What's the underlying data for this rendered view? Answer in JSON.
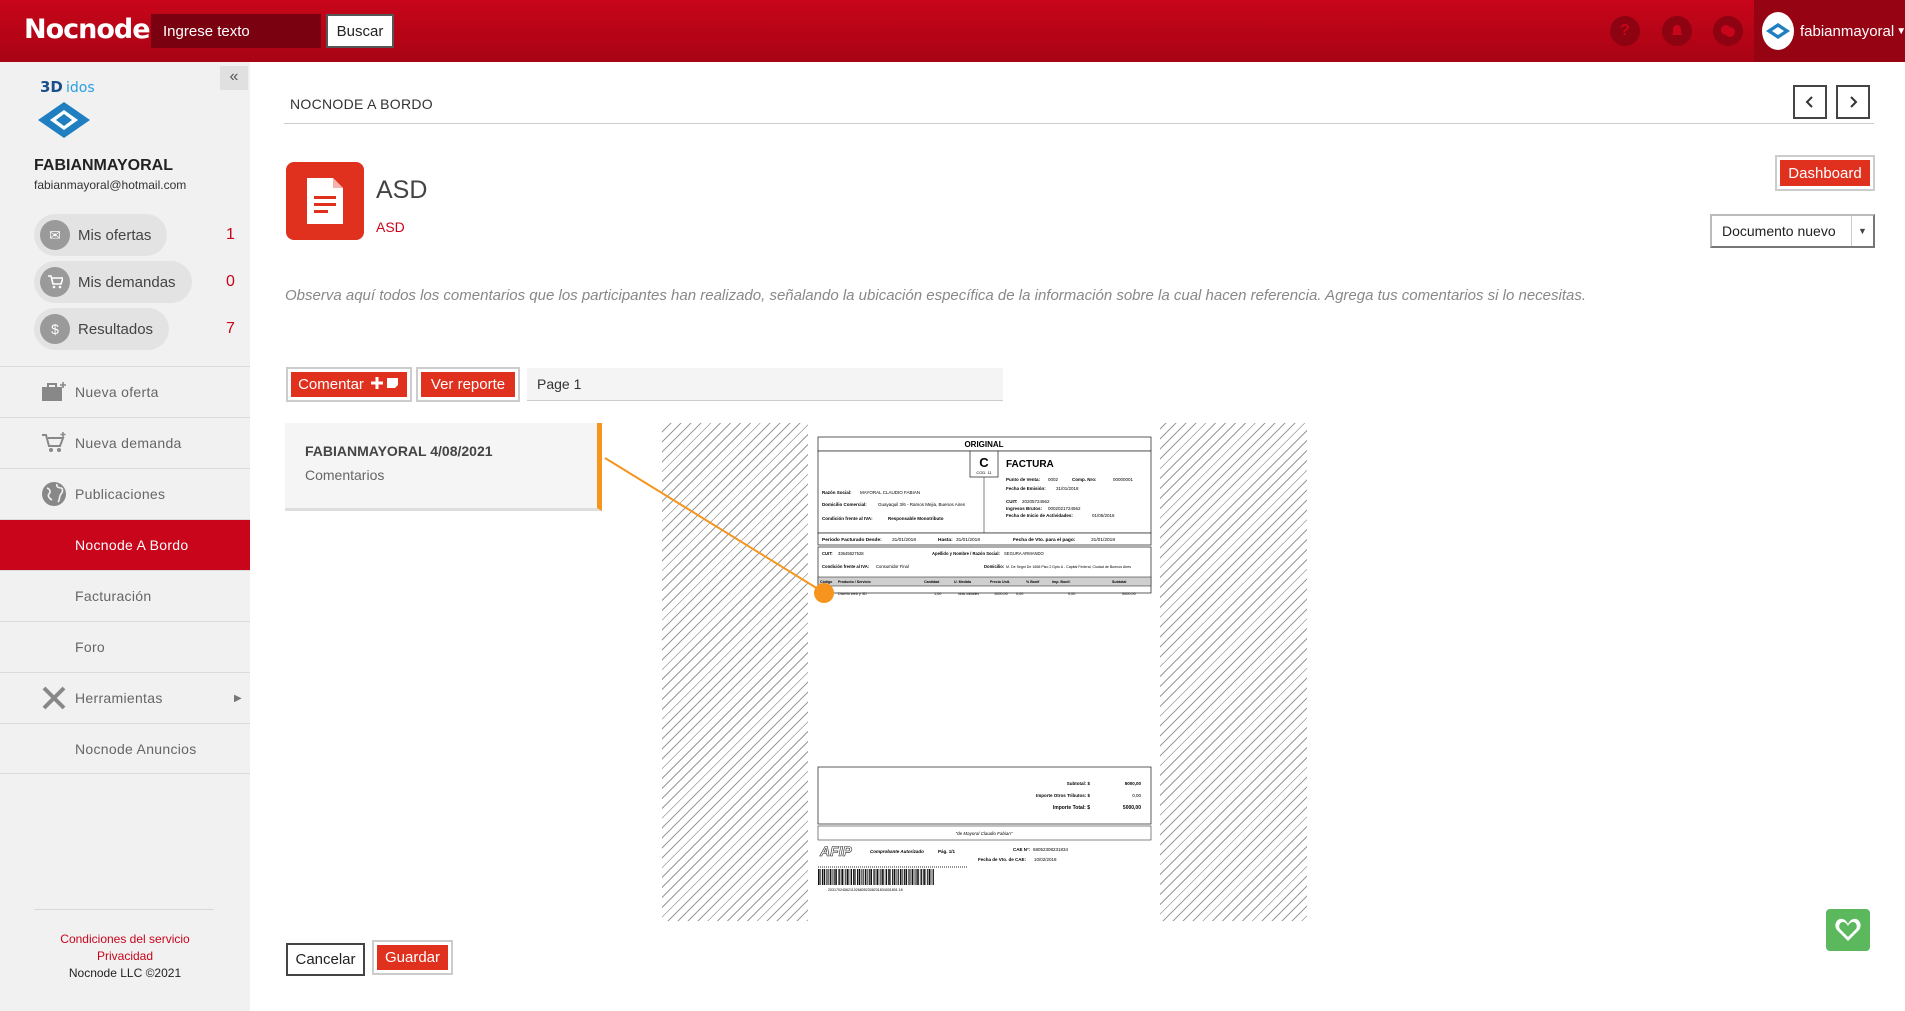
{
  "header": {
    "brand": "Nocnode",
    "search_value": "Ingrese texto",
    "search_button": "Buscar",
    "icons": [
      "help-icon",
      "bell-icon",
      "chat-icon"
    ],
    "user_name": "fabianmayoral"
  },
  "sidebar": {
    "logo_text": "3Didos",
    "profile_name": "FABIANMAYORAL",
    "profile_email": "fabianmayoral@hotmail.com",
    "stats": [
      {
        "label": "Mis ofertas",
        "count": "1",
        "icon": "envelope-icon"
      },
      {
        "label": "Mis demandas",
        "count": "0",
        "icon": "cart-icon"
      },
      {
        "label": "Resultados",
        "count": "7",
        "icon": "dollar-icon"
      }
    ],
    "nav": [
      {
        "label": "Nueva oferta",
        "icon": "briefcase-plus-icon"
      },
      {
        "label": "Nueva demanda",
        "icon": "cart-plus-icon"
      },
      {
        "label": "Publicaciones",
        "icon": "globe-icon"
      },
      {
        "label": "Nocnode A Bordo",
        "active": true
      },
      {
        "label": "Facturación"
      },
      {
        "label": "Foro"
      },
      {
        "label": "Herramientas",
        "icon": "tools-icon"
      },
      {
        "label": "Nocnode Anuncios"
      }
    ],
    "footer": {
      "terms": "Condiciones del servicio",
      "privacy": "Privacidad",
      "copyright": "Nocnode LLC ©2021"
    }
  },
  "main": {
    "breadcrumb": "NOCNODE A BORDO",
    "doc_title": "ASD",
    "doc_subtitle": "ASD",
    "dashboard_button": "Dashboard",
    "document_select": "Documento nuevo",
    "instructions": "Observa aquí todos los comentarios que los participantes han realizado, señalando la ubicación específica de la información sobre la cual hacen referencia. Agrega tus comentarios si lo necesitas.",
    "comment_button": "Comentar",
    "report_button": "Ver reporte",
    "page_label": "Page 1",
    "comment": {
      "author": "FABIANMAYORAL 4/08/2021",
      "text": "Comentarios"
    },
    "invoice": {
      "original": "ORIGINAL",
      "letter": "C",
      "letter_code": "COD. 11",
      "title": "FACTURA",
      "punto_venta": "Punto de Venta:",
      "punto_venta_val": "0002",
      "comp_nro": "Comp. Nro:",
      "comp_nro_val": "00000001",
      "fecha_emision": "Fecha de Emisión:",
      "fecha_emision_val": "31/01/2018",
      "razon_social": "Razón Social:",
      "razon_social_val": "MAYORAL CLAUDIO FABIAN",
      "domicilio": "Domicilio Comercial:",
      "domicilio_val": "Guayaquil 3/6 - Ramos Mejia, Buenos Aires",
      "condicion_iva": "Condición frente al IVA:",
      "condicion_iva_val": "Responsable Monotributo",
      "cuit": "CUIT:",
      "cuit_val": "20205724562",
      "ingresos_brutos": "Ingresos Brutos:",
      "ingresos_brutos_val": "0002021724562",
      "inicio_act": "Fecha de Inicio de Actividades:",
      "inicio_act_val": "01/05/2016",
      "periodo_desde": "Período Facturado Desde:",
      "periodo_desde_val": "31/01/2018",
      "hasta": "Hasta:",
      "hasta_val": "31/01/2018",
      "vto_pago": "Fecha de Vto. para el pago:",
      "vto_pago_val": "31/01/2018",
      "cliente_cuit": "CUIT:",
      "cliente_cuit_val": "33645827528",
      "cliente_nombre": "Apellido y Nombre / Razón Social:",
      "cliente_nombre_val": "SEGURA ARMANDO",
      "cliente_iva": "Condición frente al IVA:",
      "cliente_iva_val": "Consumidor Final",
      "cliente_dom": "Domicilio:",
      "cliente_dom_val": "M. De Segni De 1658 Piso 2 Dpto A - Capital Federal, Ciudad de Buenos Aires",
      "condicion_venta": "Condición de venta:",
      "condicion_venta_val": "Contado",
      "table_headers": [
        "Código",
        "Producto / Servicio",
        "Cantidad",
        "U. Medida",
        "Precio Unit.",
        "% Bonif",
        "Imp. Bonif.",
        "Subtotal"
      ],
      "row": [
        "",
        "Diseño web y 3D",
        "1,00",
        "otras unidades",
        "1000,00",
        "0,00",
        "0,00",
        "5000,00"
      ],
      "subtotal": "Subtotal: $",
      "subtotal_val": "5000,00",
      "otros_tributos": "Importe Otros Tributos: $",
      "otros_tributos_val": "0,00",
      "total": "Importe Total: $",
      "total_val": "5000,00",
      "signature": "\"de Mayoral Claudio Fabian\"",
      "afip": "AFIP",
      "autorizado": "Comprobante Autorizado",
      "pag": "Pág. 1/1",
      "cae": "CAE N°:",
      "cae_val": "68052308231834",
      "vto_cae": "Fecha de Vto. de CAE:",
      "vto_cae_val": "10/02/2018",
      "barcode_number": "20317024562110268052308231834001801 18"
    },
    "cancel_button": "Cancelar",
    "save_button": "Guardar"
  },
  "colors": {
    "brand_red": "#c8051a",
    "accent_orange": "#f7941d",
    "button_red": "#e0301e",
    "favorite_green": "#5cb85c"
  }
}
